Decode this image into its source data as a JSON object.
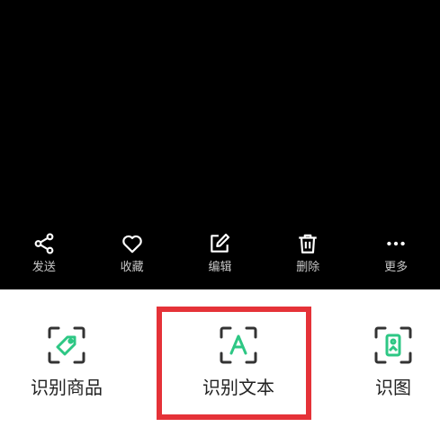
{
  "viewer": {
    "background": "#000000"
  },
  "actions": [
    {
      "id": "share",
      "label": "发送",
      "icon": "share-icon"
    },
    {
      "id": "favorite",
      "label": "收藏",
      "icon": "heart-icon"
    },
    {
      "id": "edit",
      "label": "编辑",
      "icon": "edit-icon"
    },
    {
      "id": "delete",
      "label": "删除",
      "icon": "trash-icon"
    },
    {
      "id": "more",
      "label": "更多",
      "icon": "more-dots-icon"
    }
  ],
  "recognition": {
    "items": [
      {
        "id": "product",
        "label": "识别商品",
        "icon": "tag-scan-icon"
      },
      {
        "id": "text",
        "label": "识别文本",
        "icon": "text-scan-icon"
      },
      {
        "id": "image",
        "label": "识图",
        "icon": "image-scan-icon"
      }
    ],
    "icon_frame_color": "#333333",
    "icon_accent_color": "#2dc784"
  },
  "highlight": {
    "color": "#e53238",
    "target": "text"
  }
}
